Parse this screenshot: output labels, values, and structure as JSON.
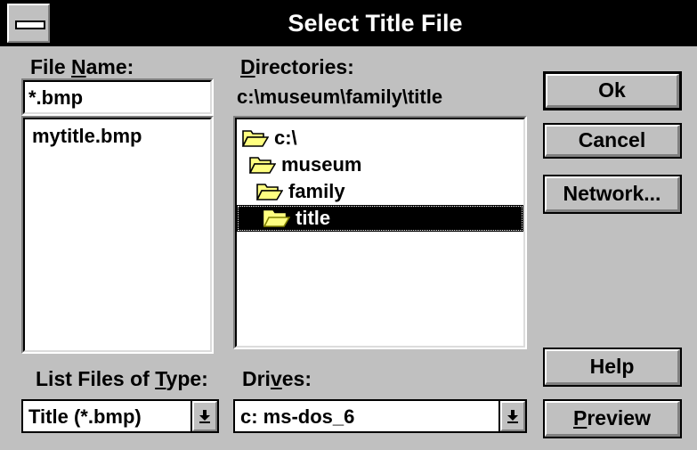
{
  "window": {
    "title": "Select Title File"
  },
  "file_name": {
    "label_pre": "File ",
    "label_key": "N",
    "label_post": "ame:",
    "value": "*.bmp",
    "files": [
      "mytitle.bmp"
    ]
  },
  "directories": {
    "label_key": "D",
    "label_post": "irectories:",
    "current_path": "c:\\museum\\family\\title",
    "items": [
      {
        "label": "c:\\",
        "icon": "open-folder-icon",
        "selected": false
      },
      {
        "label": "museum",
        "icon": "open-folder-icon",
        "selected": false
      },
      {
        "label": "family",
        "icon": "open-folder-icon",
        "selected": false
      },
      {
        "label": "title",
        "icon": "open-folder-icon",
        "selected": true
      }
    ]
  },
  "list_files_of_type": {
    "label_pre": "List Files of ",
    "label_key": "T",
    "label_post": "ype:",
    "value": "Title (*.bmp)"
  },
  "drives": {
    "label_pre": "Dri",
    "label_key": "v",
    "label_post": "es:",
    "value": "c: ms-dos_6"
  },
  "buttons": {
    "ok": "Ok",
    "cancel": "Cancel",
    "network": "Network...",
    "help": "Help",
    "preview_key": "P",
    "preview_post": "review"
  },
  "colors": {
    "face": "#c0c0c0",
    "titlebar": "#000000",
    "selection": "#000000",
    "folder": "#ffff80"
  }
}
